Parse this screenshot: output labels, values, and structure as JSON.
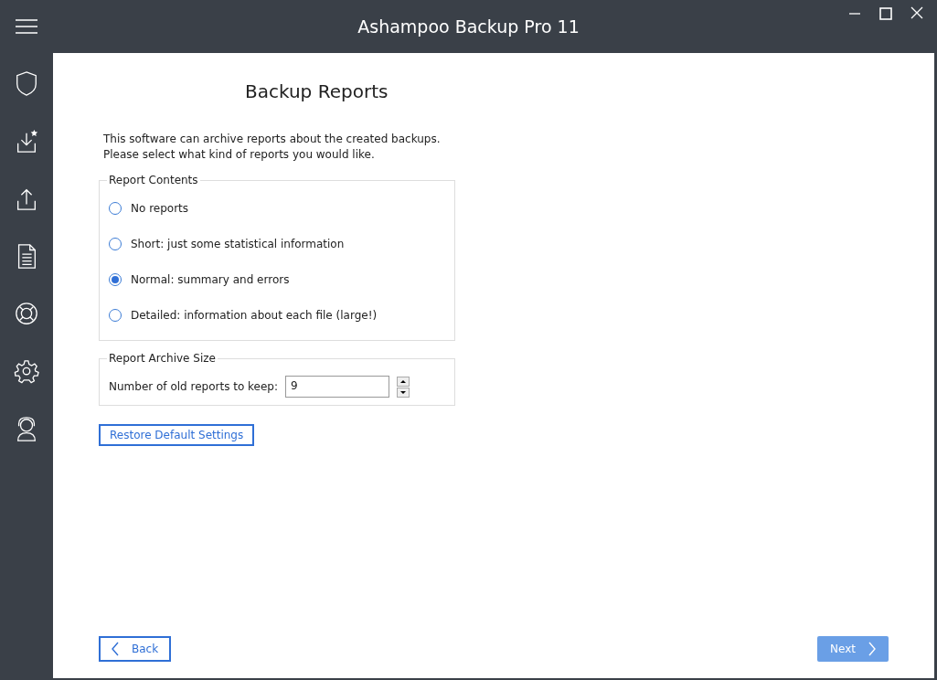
{
  "window": {
    "title": "Ashampoo Backup Pro 11"
  },
  "sidebar": {
    "items": [
      {
        "kind": "shield"
      },
      {
        "kind": "download"
      },
      {
        "kind": "upload"
      },
      {
        "kind": "document"
      },
      {
        "kind": "lifebuoy"
      },
      {
        "kind": "gear"
      },
      {
        "kind": "support"
      }
    ]
  },
  "page": {
    "title": "Backup Reports",
    "intro": [
      "This software can archive reports about the created backups.",
      "Please select what kind of reports you would like."
    ]
  },
  "report_contents": {
    "legend": "Report Contents",
    "options": [
      {
        "label": "No reports",
        "selected": false
      },
      {
        "label": "Short: just some statistical information",
        "selected": false
      },
      {
        "label": "Normal: summary and errors",
        "selected": true
      },
      {
        "label": "Detailed: information about each file (large!)",
        "selected": false
      }
    ]
  },
  "report_archive_size": {
    "legend": "Report Archive Size",
    "label": "Number of old reports to keep:",
    "value": "9"
  },
  "restore_button": "Restore Default Settings",
  "footer": {
    "back": "Back",
    "next": "Next"
  }
}
